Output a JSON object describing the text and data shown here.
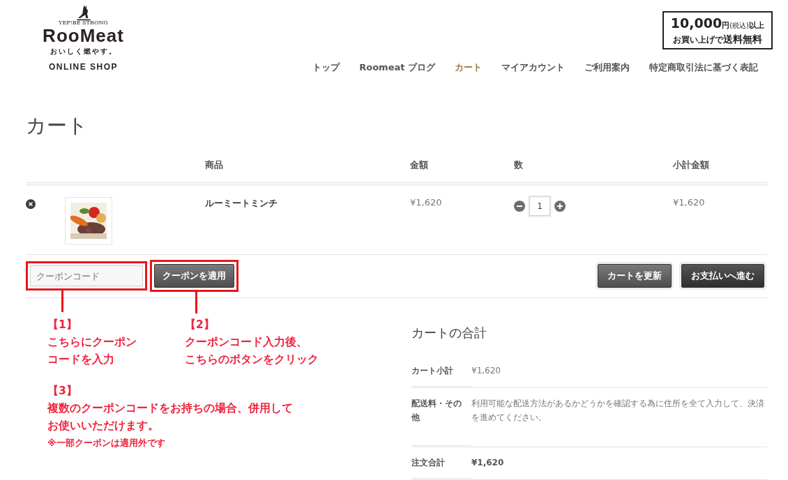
{
  "logo": {
    "arc_text": "YEP!BE STRONG",
    "name": "RooMeat",
    "tagline": "おいしく燃やす。",
    "sub": "ONLINE SHOP"
  },
  "promo": {
    "amount": "10,000",
    "unit": "円",
    "tax": "(税込)",
    "suffix": "以上",
    "line2": "お買い上げで",
    "highlight": "送料無料"
  },
  "nav": [
    {
      "label": "トップ",
      "selected": false
    },
    {
      "label": "Roomeat ブログ",
      "selected": false
    },
    {
      "label": "カート",
      "selected": true
    },
    {
      "label": "マイアカウント",
      "selected": false
    },
    {
      "label": "ご利用案内",
      "selected": false
    },
    {
      "label": "特定商取引法に基づく表記",
      "selected": false
    }
  ],
  "page_title": "カート",
  "cart": {
    "columns": [
      "商品",
      "金額",
      "数",
      "小計金額"
    ],
    "rows": [
      {
        "product": "ルーミートミンチ",
        "price": "¥1,620",
        "quantity": "1",
        "subtotal": "¥1,620"
      }
    ]
  },
  "coupon": {
    "placeholder": "クーポンコード",
    "apply": "クーポンを適用"
  },
  "actions": [
    "カートを更新",
    "お支払いへ進む"
  ],
  "annotations": [
    {
      "lines": [
        "【1】",
        "こちらにクーポン",
        "コードを入力"
      ]
    },
    {
      "lines": [
        "【2】",
        "クーポンコード入力後、",
        "こちらのボタンをクリック"
      ]
    },
    {
      "lines": [
        "【3】",
        "複数のクーポンコードをお持ちの場合、併用して",
        "お使いいただけます。"
      ],
      "note": "※一部クーポンは適用外です"
    }
  ],
  "totals": {
    "title": "カートの合計",
    "rows": [
      {
        "label": "カート小計",
        "value": "¥1,620",
        "bold": false
      },
      {
        "label": "配送料・その他",
        "value": "利用可能な配送方法があるかどうかを確認する為に住所を全て入力して、決済を進めてください。",
        "bold": false
      },
      {
        "label": "注文合計",
        "value": "¥1,620",
        "bold": true
      }
    ]
  }
}
